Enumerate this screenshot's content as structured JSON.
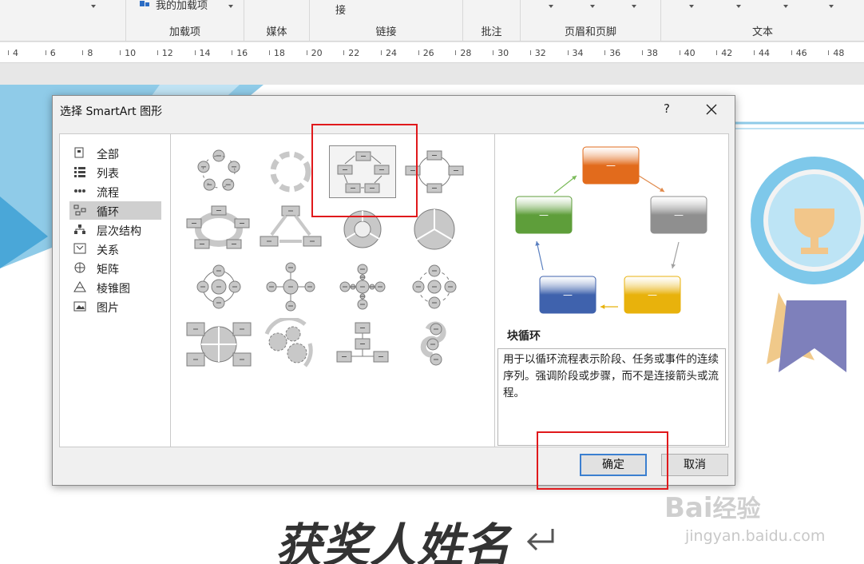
{
  "ribbon": {
    "addins_button": "我的加载项",
    "link_partial": "接",
    "groups": [
      "加载项",
      "媒体",
      "链接",
      "批注",
      "页眉和页脚",
      "文本"
    ]
  },
  "ruler": {
    "numbers": [
      "4",
      "6",
      "8",
      "10",
      "12",
      "14",
      "16",
      "18",
      "20",
      "22",
      "24",
      "26",
      "28",
      "30",
      "32",
      "34",
      "36",
      "38",
      "40",
      "42",
      "44",
      "46",
      "48"
    ]
  },
  "dialog": {
    "title": "选择 SmartArt 图形",
    "help": "?",
    "categories": [
      {
        "label": "全部",
        "icon": "all-icon"
      },
      {
        "label": "列表",
        "icon": "list-icon"
      },
      {
        "label": "流程",
        "icon": "process-icon"
      },
      {
        "label": "循环",
        "icon": "cycle-icon",
        "selected": true
      },
      {
        "label": "层次结构",
        "icon": "hierarchy-icon"
      },
      {
        "label": "关系",
        "icon": "relationship-icon"
      },
      {
        "label": "矩阵",
        "icon": "matrix-icon"
      },
      {
        "label": "棱锥图",
        "icon": "pyramid-icon"
      },
      {
        "label": "图片",
        "icon": "picture-icon"
      }
    ],
    "selected_layout_index": 2,
    "preview": {
      "name": "块循环",
      "description": "用于以循环流程表示阶段、任务或事件的连续序列。强调阶段或步骤，而不是连接箭头或流程。",
      "shape_label": "—",
      "colors": [
        "#e26b1c",
        "#8f8f8f",
        "#e8b20c",
        "#3f62ad",
        "#5e9e3a"
      ]
    },
    "ok_label": "确定",
    "cancel_label": "取消"
  },
  "document": {
    "headline": "获奖人姓名"
  },
  "watermark": {
    "brand": "Bai",
    "brand_tail": "经验",
    "url": "jingyan.baidu.com"
  }
}
